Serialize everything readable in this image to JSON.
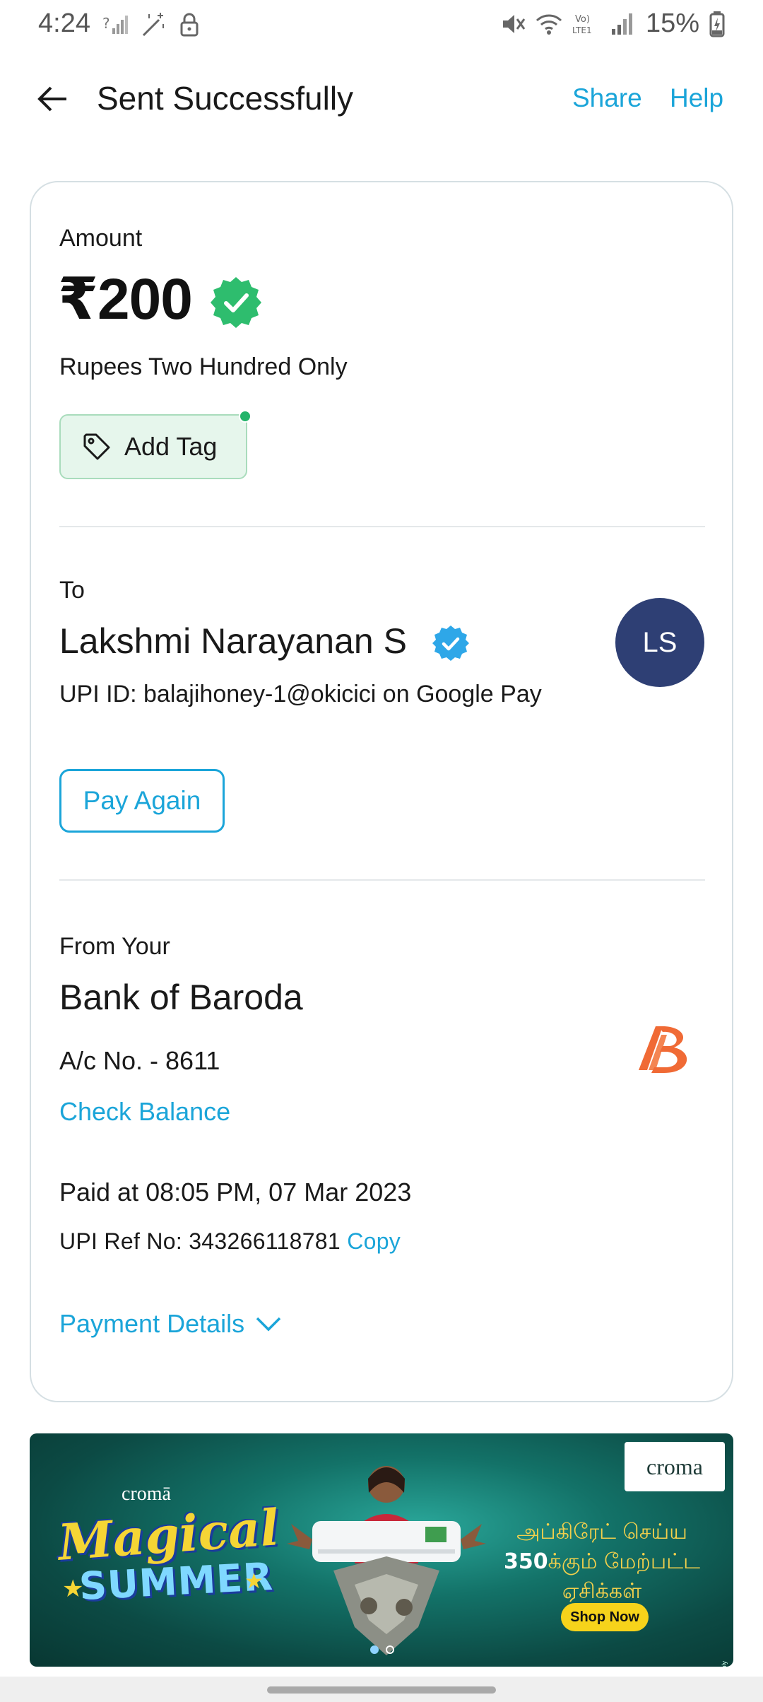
{
  "status_bar": {
    "time": "4:24",
    "battery": "15%",
    "icons": [
      "signal-unknown-icon",
      "magic-wand-icon",
      "lock-icon",
      "mute-icon",
      "wifi-icon",
      "volte-icon",
      "cell-signal-icon",
      "battery-charging-icon"
    ]
  },
  "header": {
    "title": "Sent Successfully",
    "share": "Share",
    "help": "Help"
  },
  "amount": {
    "label": "Amount",
    "value": "₹200",
    "words": "Rupees Two Hundred Only",
    "tag_button": "Add Tag"
  },
  "payee": {
    "label": "To",
    "name": "Lakshmi Narayanan S",
    "upi": "UPI ID: balajihoney-1@okicici on Google Pay",
    "initials": "LS",
    "pay_again": "Pay Again"
  },
  "source": {
    "label": "From Your",
    "bank": "Bank of Baroda",
    "account": "A/c No. - 8611",
    "check_balance": "Check Balance"
  },
  "transaction": {
    "paid_at": "Paid at 08:05 PM, 07 Mar 2023",
    "ref_label": "UPI Ref No: 343266118781",
    "copy": "Copy",
    "details": "Payment Details"
  },
  "banner": {
    "brand": "croma",
    "brand_small": "cromā",
    "headline1": "Magical",
    "headline2": "SUMMER",
    "tamil1": "அப்கிரேட் செய்ய",
    "tamil2_bold": "350",
    "tamil2": "க்கும் மேற்பட்ட",
    "tamil3": "ஏசிக்கள்",
    "cta": "Shop Now",
    "tnc": "*T&C Apply",
    "slide_count": 2,
    "active_slide": 1
  },
  "colors": {
    "accent": "#1ba5d9",
    "verified_green": "#2ebd6e",
    "verified_blue": "#2ea7e8",
    "avatar_bg": "#2e3f74",
    "tag_bg": "#e6f6ec",
    "bank_orange": "#f06a35"
  }
}
